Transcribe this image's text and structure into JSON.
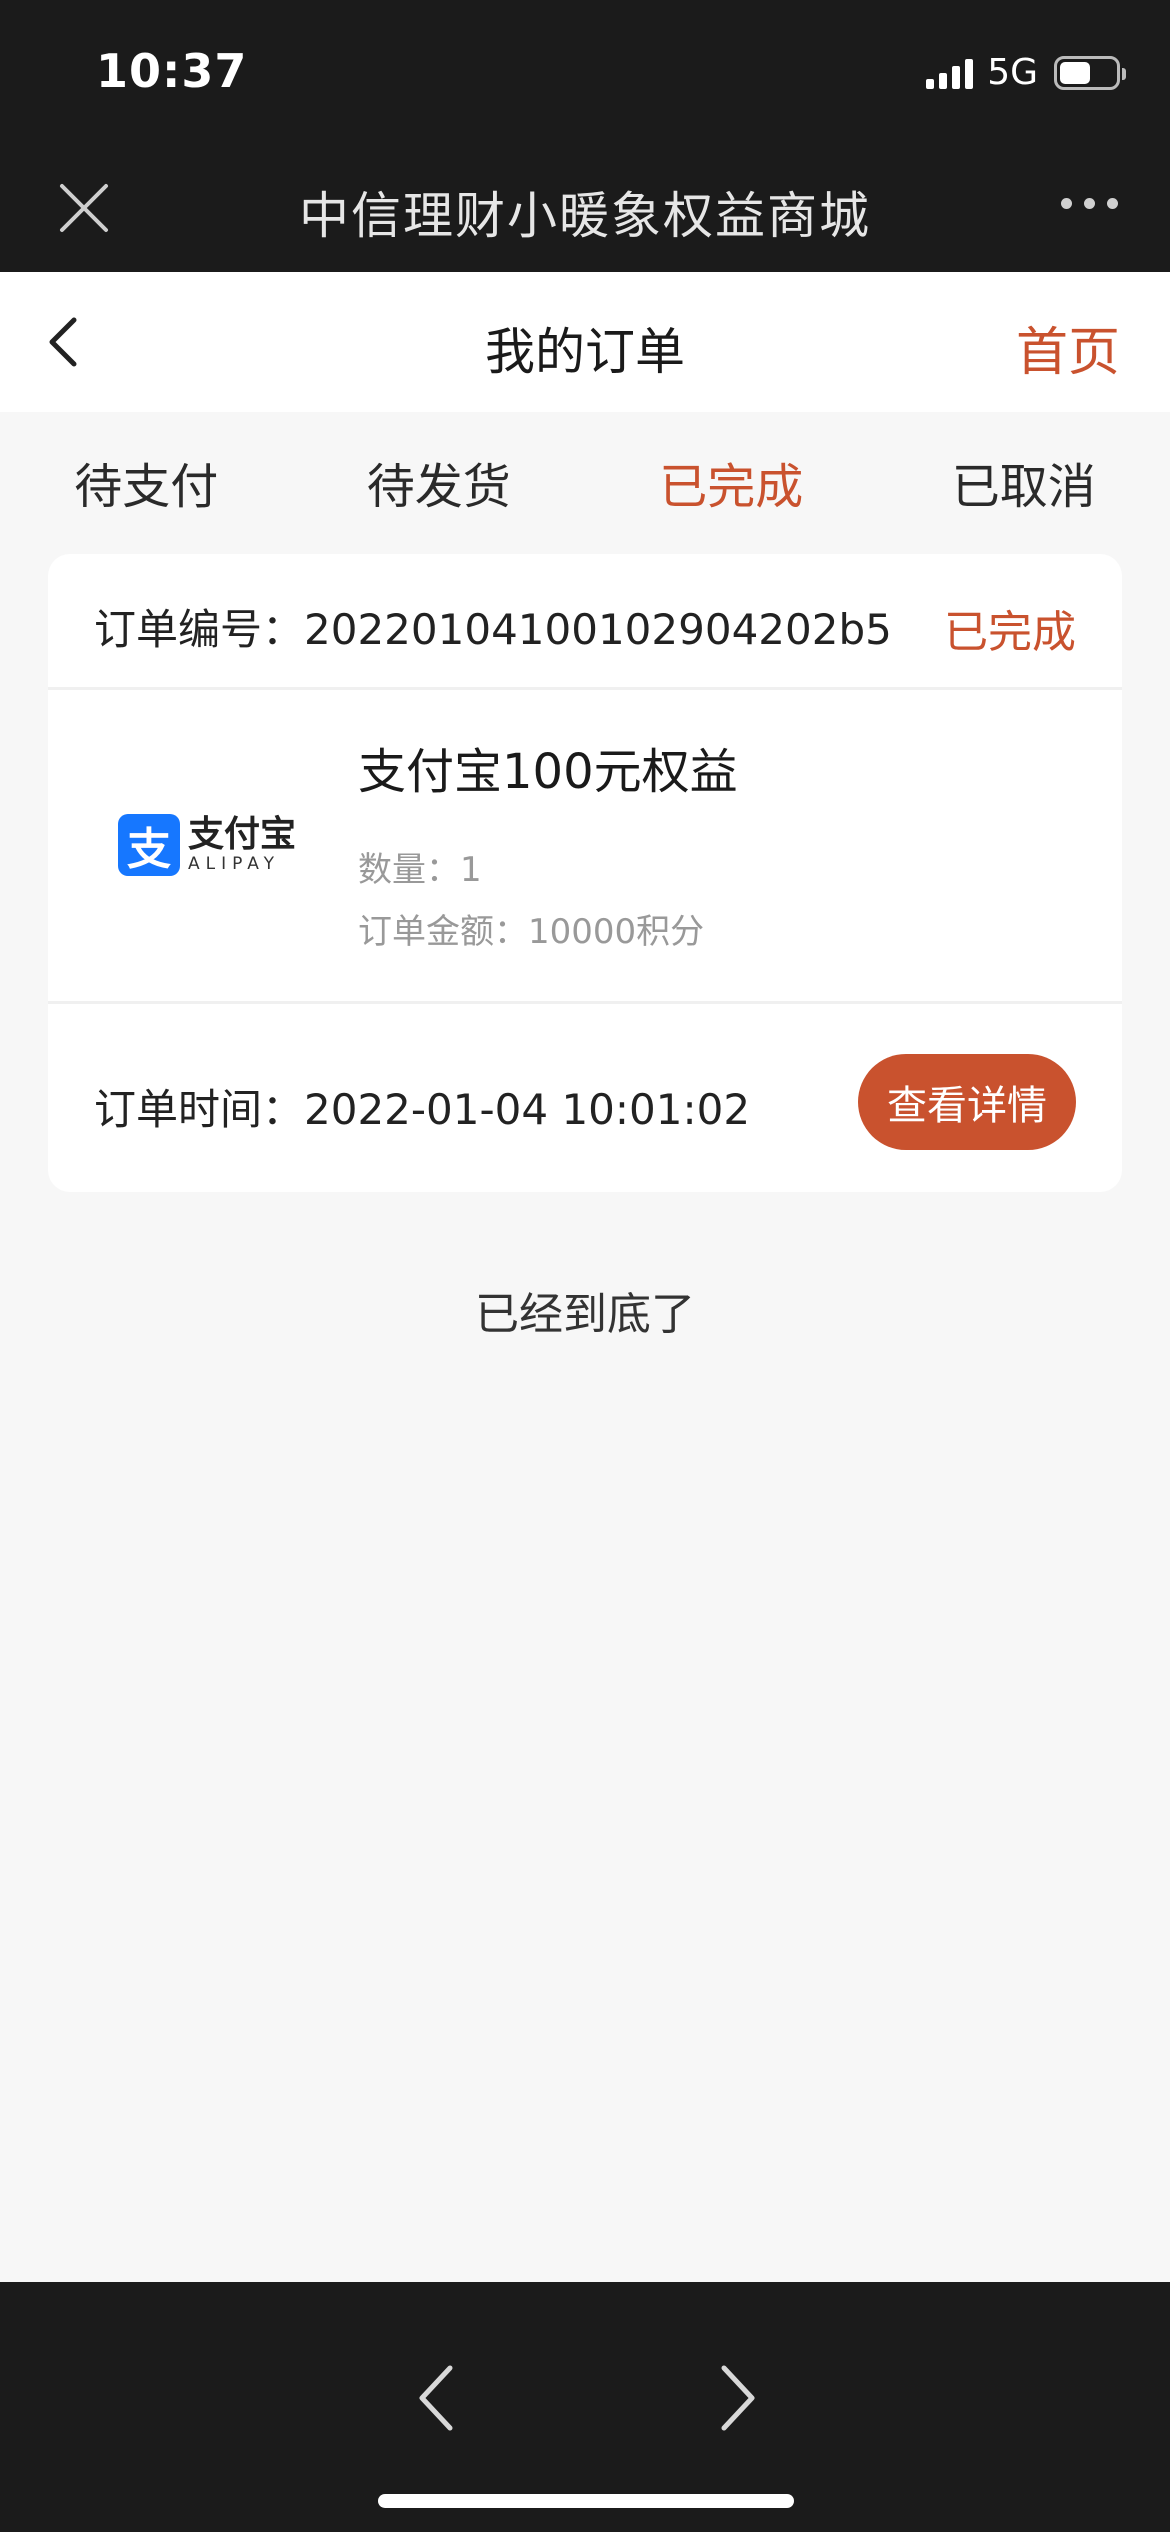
{
  "status_bar": {
    "time": "10:37",
    "network": "5G",
    "battery_level": 0.55
  },
  "title_bar": {
    "title": "中信理财小暖象权益商城",
    "close_icon": "close-icon",
    "more_icon": "more-icon"
  },
  "header": {
    "title": "我的订单",
    "home_label": "首页",
    "back_icon": "chevron-left-icon"
  },
  "tabs": [
    {
      "label": "待支付",
      "active": false
    },
    {
      "label": "待发货",
      "active": false
    },
    {
      "label": "已完成",
      "active": true
    },
    {
      "label": "已取消",
      "active": false
    }
  ],
  "order": {
    "number_label": "订单编号：",
    "number": "2022010410010290420 2b5",
    "status": "已完成",
    "product": {
      "logo_icon": "支",
      "logo_cn": "支付宝",
      "logo_en": "ALIPAY",
      "name": "支付宝100元权益",
      "qty_label": "数量：",
      "qty": "1",
      "amount_label": "订单金额：",
      "amount": "10000积分"
    },
    "time_label": "订单时间：",
    "time": "2022-01-04 10:01:02",
    "detail_button": "查看详情"
  },
  "end_text": "已经到底了",
  "colors": {
    "accent": "#c9522e",
    "alipay_blue": "#1677ff",
    "dark_bar": "#1b1b1b"
  }
}
